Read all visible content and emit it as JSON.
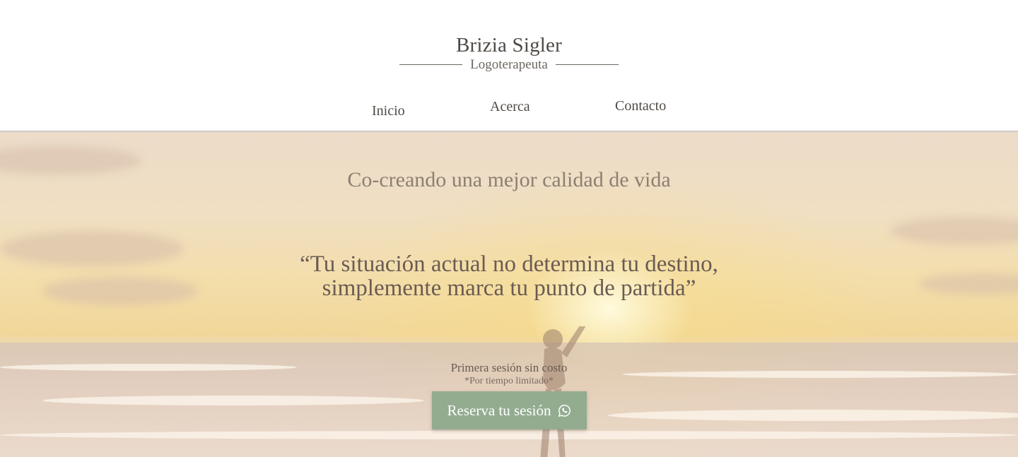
{
  "brand": {
    "name": "Brizia Sigler",
    "subtitle": "Logoterapeuta"
  },
  "nav": {
    "items": [
      {
        "label": "Inicio"
      },
      {
        "label": "Acerca"
      },
      {
        "label": "Contacto"
      }
    ]
  },
  "hero": {
    "tagline": "Co-creando una mejor calidad de vida",
    "quote_line1": "“Tu situación actual no determina tu destino,",
    "quote_line2": "simplemente marca tu punto de partida”",
    "offer_title": "Primera sesión sin costo",
    "offer_note": "*Por tiempo limitado*",
    "cta_label": "Reserva tu sesión",
    "cta_icon": "whatsapp-icon"
  },
  "colors": {
    "cta_background": "#93ac90",
    "text_dark": "#4f4a45",
    "quote_text": "#6a5b53"
  }
}
